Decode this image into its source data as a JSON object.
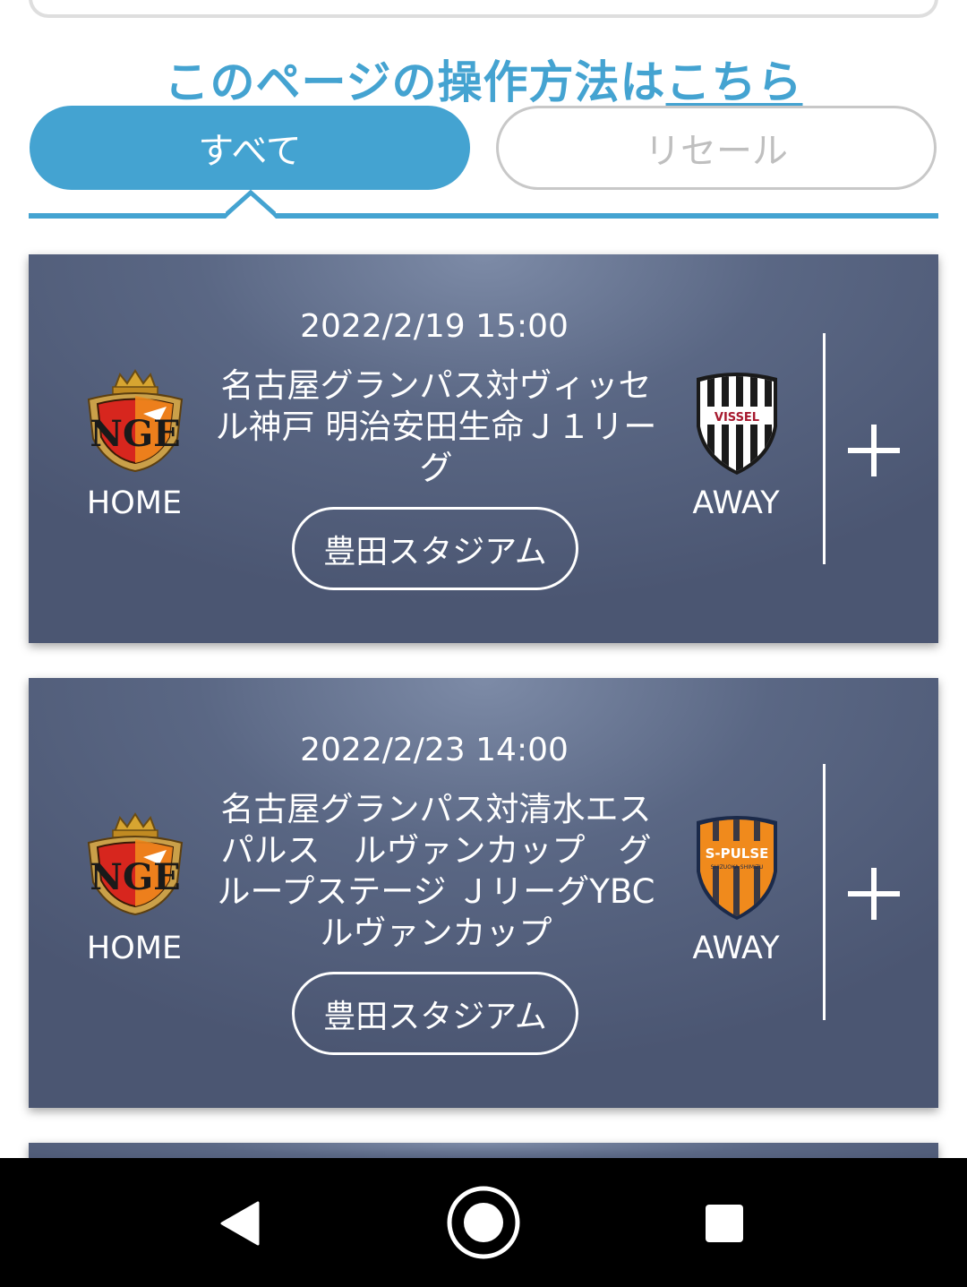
{
  "help": {
    "text": "このページの操作方法は",
    "link": "こちら"
  },
  "tabs": [
    {
      "label": "すべて",
      "active": true
    },
    {
      "label": "リセール",
      "active": false
    }
  ],
  "matches": [
    {
      "datetime": "2022/2/19 15:00",
      "title": "名古屋グランパス対ヴィッセル神戸 明治安田生命Ｊ１リーグ",
      "venue": "豊田スタジアム",
      "home_label": "HOME",
      "away_label": "AWAY",
      "home_emblem": "nagoya-grampus-emblem",
      "away_emblem": "vissel-kobe-emblem"
    },
    {
      "datetime": "2022/2/23 14:00",
      "title": "名古屋グランパス対清水エスパルス　ルヴァンカップ　グループステージ ＪリーグYBCルヴァンカップ",
      "venue": "豊田スタジアム",
      "home_label": "HOME",
      "away_label": "AWAY",
      "home_emblem": "nagoya-grampus-emblem",
      "away_emblem": "shimizu-s-pulse-emblem"
    }
  ],
  "emblem_text": {
    "nagoya_letters": "NGE",
    "vissel": "VISSEL",
    "spulse": "S-PULSE",
    "spulse_sub": "SHIZUOKA SHIMIZU"
  },
  "colors": {
    "accent": "#44a3d1",
    "card_dark": "#4b5672",
    "card_light": "#7d8ba7",
    "grampus_red": "#d7261e",
    "spulse_orange": "#f08a1c"
  },
  "navbar": {
    "icons": [
      "back-icon",
      "home-icon",
      "recents-icon"
    ]
  }
}
